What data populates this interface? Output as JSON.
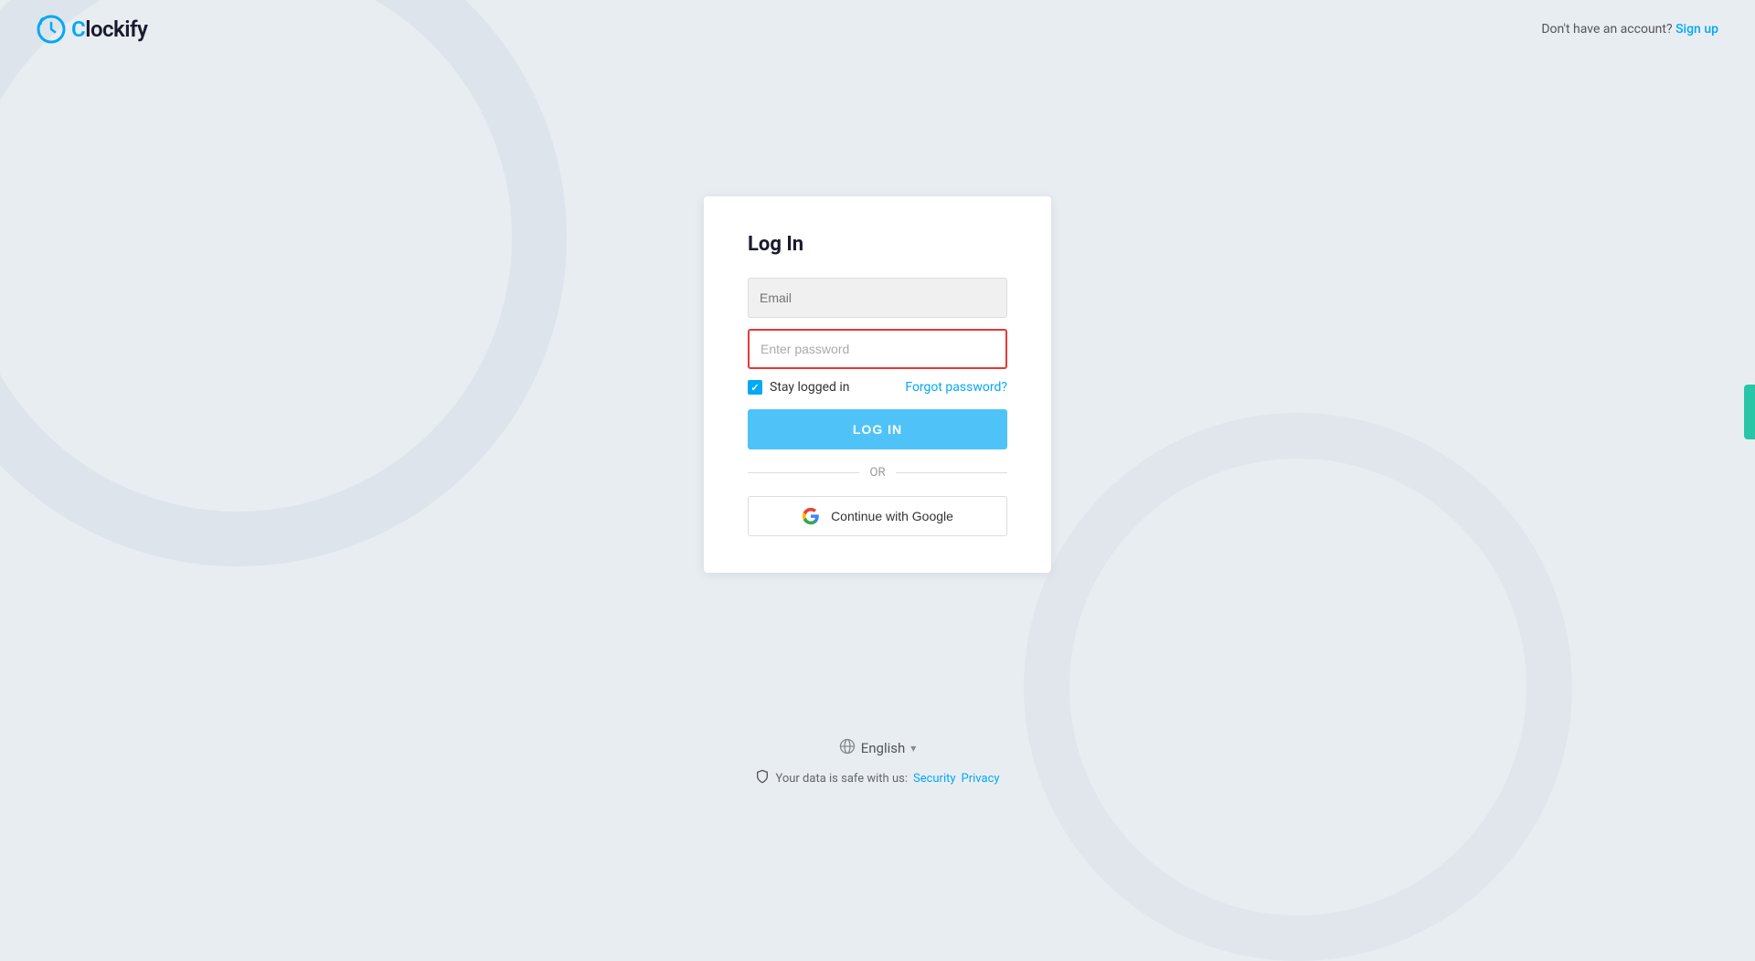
{
  "header": {
    "logo_text": "lockify",
    "no_account_text": "Don't have an account?",
    "signup_label": "Sign up"
  },
  "login_card": {
    "title": "Log In",
    "email_placeholder": "Email",
    "email_value": "",
    "password_placeholder": "Enter password",
    "stay_logged_in_label": "Stay logged in",
    "forgot_password_label": "Forgot password?",
    "login_button_label": "LOG IN",
    "or_text": "OR",
    "google_button_label": "Continue with Google"
  },
  "footer": {
    "language_label": "English",
    "security_text": "Your data is safe with us:",
    "security_link": "Security",
    "privacy_link": "Privacy"
  }
}
